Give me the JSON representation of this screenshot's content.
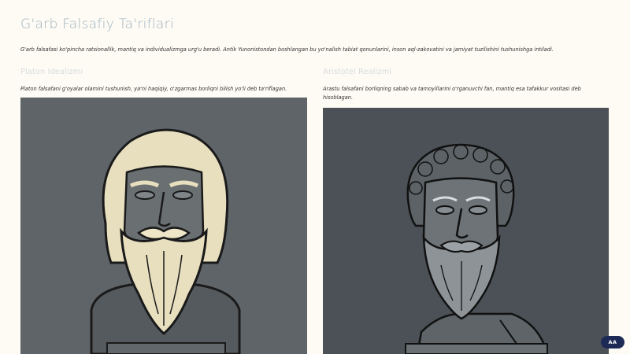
{
  "page": {
    "title": "G'arb Falsafiy Ta'riflari",
    "intro": "G'arb falsafasi ko'pincha ratsionallik, mantiq va individualizmga urg'u beradi. Antik Yunonistondan boshlangan bu yo'nalish tabiat qonunlarini, inson aql-zakovatini va jamiyat tuzilishini tushunishga intiladi."
  },
  "columns": [
    {
      "title": "Platon Idealizmi",
      "description": "Platon falsafani g'oyalar olamini tushunish, ya'ni haqiqiy, o'zgarmas borliqni bilish yo'li deb ta'riflagan.",
      "image_icon": "plato-bust-illustration"
    },
    {
      "title": "Aristotel Realizmi",
      "description": "Arastu falsafani borliqning sabab va tamoyillarini o'rganuvchi fan, mantiq esa tafakkur vositasi deb hisoblagan.",
      "image_icon": "aristotle-bust-illustration"
    }
  ],
  "lang_toggle": {
    "label": "AA"
  },
  "colors": {
    "title": "#9fb3c2",
    "panel_left": "#5f6468",
    "panel_right": "#4b5156",
    "pill": "#1d2a55"
  }
}
